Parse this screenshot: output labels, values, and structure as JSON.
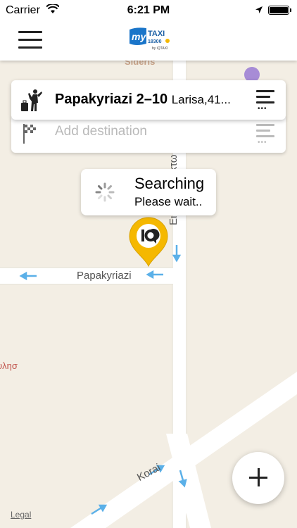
{
  "status_bar": {
    "carrier": "Carrier",
    "time": "6:21 PM"
  },
  "header": {
    "logo_text": "my TAXI 18300",
    "logo_sub": "by iQTAXI"
  },
  "pickup": {
    "street": "Papakyriazi 2–10",
    "city": "Larisa,41..."
  },
  "destination": {
    "placeholder": "Add destination"
  },
  "search_status": {
    "title": "Searching",
    "subtitle": "Please wait.."
  },
  "map": {
    "labels": {
      "papakyriazi": "Papakyriazi",
      "oktovriou": "Εικοστής Οκτω",
      "korai": "Korai",
      "sideris": "Sideris",
      "greek_poi_line1": "υλησ",
      "greek_poi_line2": "ι",
      "legal": "Legal"
    },
    "colors": {
      "background": "#f3eee4",
      "road": "#ffffff",
      "arrow": "#5bb0e8",
      "marker": "#f5b800"
    }
  },
  "icons": {
    "pickup": "hitchhiker-icon",
    "destination": "checkered-flag-icon",
    "add": "plus-icon"
  }
}
